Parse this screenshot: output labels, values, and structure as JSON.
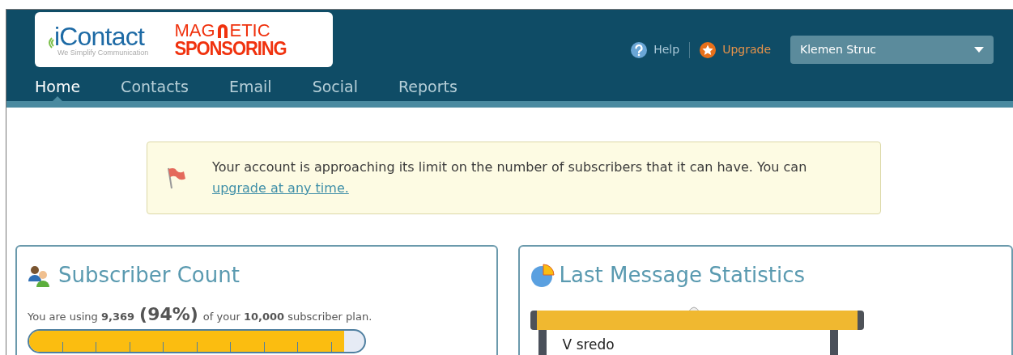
{
  "logo": {
    "brand": "iContact",
    "tagline": "We Simplify Communication",
    "partner_left": "MAG",
    "partner_right": "ETIC",
    "partner_line2": "SPONSORING"
  },
  "header_links": [
    {
      "kind": "help",
      "label": "Help"
    },
    {
      "kind": "upgrade",
      "label": "Upgrade"
    }
  ],
  "account_menu": {
    "value": "Klemen Struc"
  },
  "nav": [
    {
      "label": "Home",
      "selected": true
    },
    {
      "label": "Contacts",
      "selected": false
    },
    {
      "label": "Email",
      "selected": false
    },
    {
      "label": "Social",
      "selected": false
    },
    {
      "label": "Reports",
      "selected": false
    }
  ],
  "alert": {
    "message": "Your account is approaching its limit on the number of subscribers that it can have. You can",
    "link": "upgrade at any time."
  },
  "subscriber_panel": {
    "title": "Subscriber Count",
    "usage_text": "You are using **9,369**",
    "percent": "(94%)",
    "plan_text": "of your **10,000** subscriber plan.",
    "level": 0.94
  },
  "stats_panel": {
    "title": "Last Message Statistics",
    "board_text": "V sredo"
  }
}
